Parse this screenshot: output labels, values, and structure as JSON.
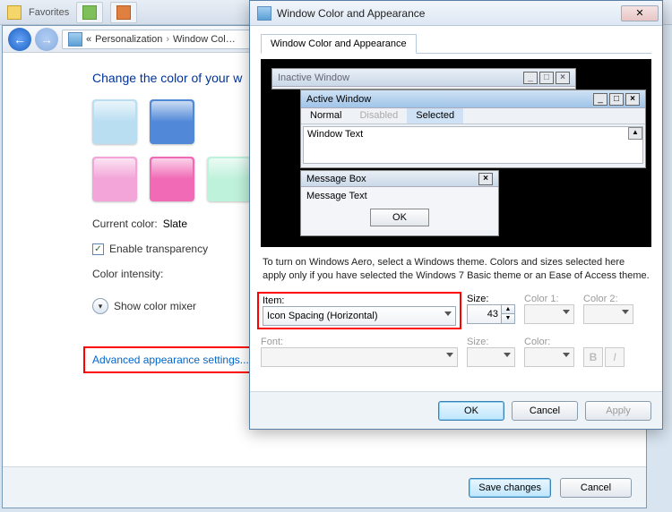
{
  "top": {
    "favorites": "Favorites"
  },
  "breadcrumb": {
    "root": "«",
    "item1": "Personalization",
    "item2": "Window Col…"
  },
  "page": {
    "heading": "Change the color of your w",
    "current_label": "Current color:",
    "current_value": "Slate",
    "transparency": "Enable transparency",
    "intensity": "Color intensity:",
    "mixer": "Show color mixer",
    "advanced": "Advanced appearance settings...",
    "save": "Save changes",
    "cancel": "Cancel"
  },
  "dialog": {
    "title": "Window Color and Appearance",
    "tab": "Window Color and Appearance",
    "preview": {
      "inactive": "Inactive Window",
      "active": "Active Window",
      "menu_normal": "Normal",
      "menu_disabled": "Disabled",
      "menu_selected": "Selected",
      "window_text": "Window Text",
      "msgbox": "Message Box",
      "msgtext": "Message Text",
      "ok": "OK"
    },
    "hint": "To turn on Windows Aero, select a Windows theme.  Colors and sizes selected here apply only if you have selected the Windows 7 Basic theme or an Ease of Access theme.",
    "form": {
      "item_label": "Item:",
      "item_value": "Icon Spacing (Horizontal)",
      "size_label": "Size:",
      "size_value": "43",
      "color1_label": "Color 1:",
      "color2_label": "Color 2:",
      "font_label": "Font:",
      "fsize_label": "Size:",
      "fcolor_label": "Color:",
      "bold": "B",
      "italic": "I"
    },
    "buttons": {
      "ok": "OK",
      "cancel": "Cancel",
      "apply": "Apply"
    }
  }
}
